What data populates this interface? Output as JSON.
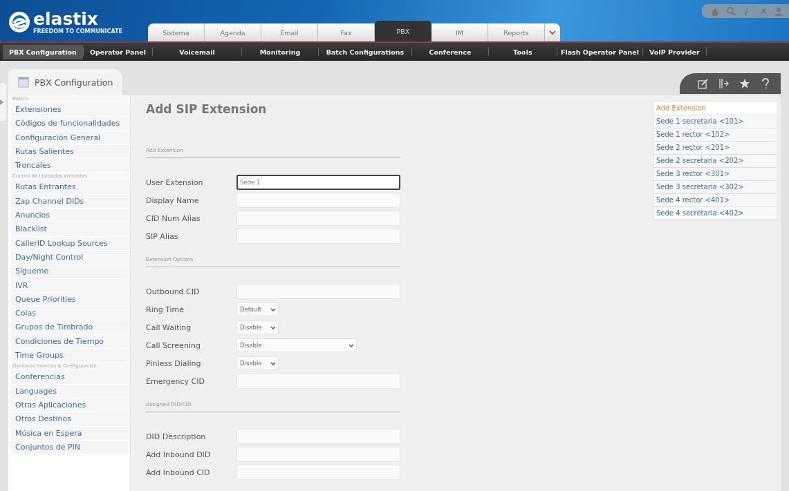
{
  "header": {
    "logo": "elastix",
    "tagline": "FREEDOM TO COMMUNICATE",
    "tabs": [
      {
        "label": "Sistema",
        "selected": false
      },
      {
        "label": "Agenda",
        "selected": false
      },
      {
        "label": "Email",
        "selected": false
      },
      {
        "label": "Fax",
        "selected": false
      },
      {
        "label": "PBX",
        "selected": true
      },
      {
        "label": "IM",
        "selected": false
      },
      {
        "label": "Reports",
        "selected": false
      }
    ]
  },
  "submenu": [
    {
      "label": "PBX Configuration",
      "selected": true
    },
    {
      "label": "Operator Panel",
      "selected": false
    },
    {
      "label": "Voicemail",
      "selected": false
    },
    {
      "label": "Monitoring",
      "selected": false
    },
    {
      "label": "Batch Configurations",
      "selected": false
    },
    {
      "label": "Conference",
      "selected": false
    },
    {
      "label": "Tools",
      "selected": false
    },
    {
      "label": "Flash Operator Panel",
      "selected": false
    },
    {
      "label": "VoIP Provider",
      "selected": false
    }
  ],
  "module_tab": {
    "title": "PBX Configuration"
  },
  "sidebar": {
    "sections": [
      {
        "title": "Basics",
        "items": [
          "Extensiones",
          "Códigos de funcionalidades",
          "Configuración General",
          "Rutas Salientes",
          "Troncales"
        ]
      },
      {
        "title": "Control de Llamadas entrantes",
        "items": [
          "Rutas Entrantes",
          "Zap Channel DIDs",
          "Anuncios",
          "Blacklist",
          "CallerID Lookup Sources",
          "Day/Night Control",
          "Sígueme",
          "IVR",
          "Queue Priorities",
          "Colas",
          "Grupos de Timbrado",
          "Condiciones de Tiempo",
          "Time Groups"
        ]
      },
      {
        "title": "Opciones Internas & Configuración",
        "items": [
          "Conferencias",
          "Languages",
          "Otras Aplicaciones",
          "Otros Destinos",
          "Música en Espera",
          "Conjuntos de PIN"
        ]
      }
    ]
  },
  "form": {
    "title": "Add SIP Extension",
    "sections": [
      {
        "title": "Add Extension",
        "fields": [
          {
            "label": "User Extension",
            "kind": "text",
            "value": "Sede 1",
            "focused": true
          },
          {
            "label": "Display Name",
            "kind": "text",
            "focused": false
          },
          {
            "label": "CID Num Alias",
            "kind": "text",
            "focused": false
          },
          {
            "label": "SIP Alias",
            "kind": "text",
            "focused": false
          }
        ]
      },
      {
        "title": "Extension Options",
        "fields": [
          {
            "label": "Outbound CID",
            "kind": "text",
            "focused": false
          },
          {
            "label": "Ring Time",
            "kind": "select",
            "value": "Default"
          },
          {
            "label": "Call Waiting",
            "kind": "select",
            "value": "Disable"
          },
          {
            "label": "Call Screening",
            "kind": "combo",
            "value": "Disable"
          },
          {
            "label": "Pinless Dialing",
            "kind": "select",
            "value": "Disable"
          },
          {
            "label": "Emergency CID",
            "kind": "text",
            "focused": false
          }
        ]
      },
      {
        "title": "Assigned DID/CID",
        "fields": [
          {
            "label": "DID Description",
            "kind": "text",
            "focused": false
          },
          {
            "label": "Add Inbound DID",
            "kind": "text",
            "focused": false
          },
          {
            "label": "Add Inbound CID",
            "kind": "text",
            "focused": false
          }
        ]
      }
    ]
  },
  "extension_list": [
    {
      "label": "Add Extension",
      "selected": true
    },
    {
      "label": "Sede 1 secretaria <101>",
      "selected": false
    },
    {
      "label": "Sede 1 rector <102>",
      "selected": false
    },
    {
      "label": "Sede 2 rector <201>",
      "selected": false
    },
    {
      "label": "Sede 2 secretaria <202>",
      "selected": false
    },
    {
      "label": "Sede 3 rector <301>",
      "selected": false
    },
    {
      "label": "Sede 3 secretaria <302>",
      "selected": false
    },
    {
      "label": "Sede 4 rector <401>",
      "selected": false
    },
    {
      "label": "Sede 4 secretaria <402>",
      "selected": false
    }
  ]
}
